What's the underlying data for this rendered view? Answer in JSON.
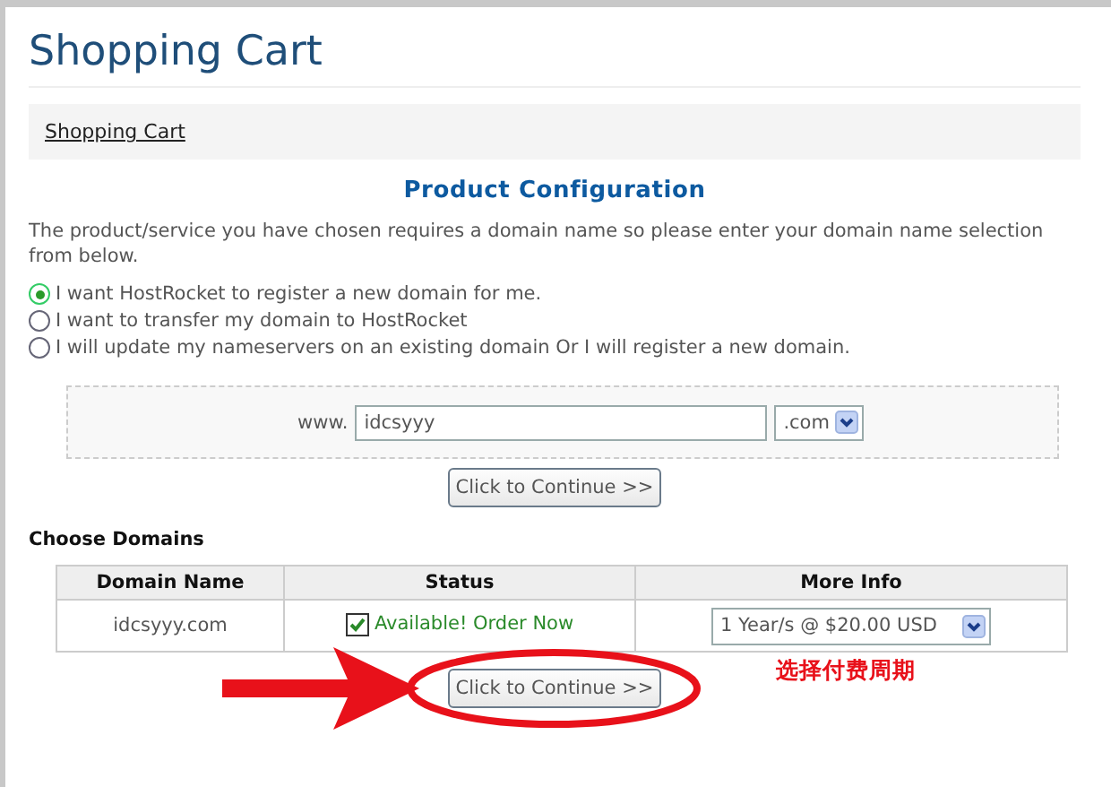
{
  "page": {
    "title": "Shopping Cart"
  },
  "breadcrumb": [
    {
      "label": "Shopping Cart"
    }
  ],
  "configuration": {
    "title": "Product Configuration",
    "intro": "The product/service you have chosen requires a domain name so please enter your domain name selection from below.",
    "options": [
      {
        "label": "I want HostRocket to register a new domain for me.",
        "selected": true
      },
      {
        "label": "I want to transfer my domain to HostRocket",
        "selected": false
      },
      {
        "label": "I will update my nameservers on an existing domain Or I will register a new domain.",
        "selected": false
      }
    ],
    "domain_entry": {
      "prefix": "www.",
      "value": "idcsyyy",
      "tld": ".com"
    },
    "button": "Click to Continue >>"
  },
  "choose_domains": {
    "title": "Choose Domains",
    "columns": [
      "Domain Name",
      "Status",
      "More Info"
    ],
    "rows": [
      {
        "domain": "idcsyyy.com",
        "checked": true,
        "status": "Available! Order Now",
        "term": "1 Year/s @ $20.00 USD"
      }
    ],
    "button": "Click to Continue >>"
  },
  "annotation": {
    "text": "选择付费周期"
  }
}
